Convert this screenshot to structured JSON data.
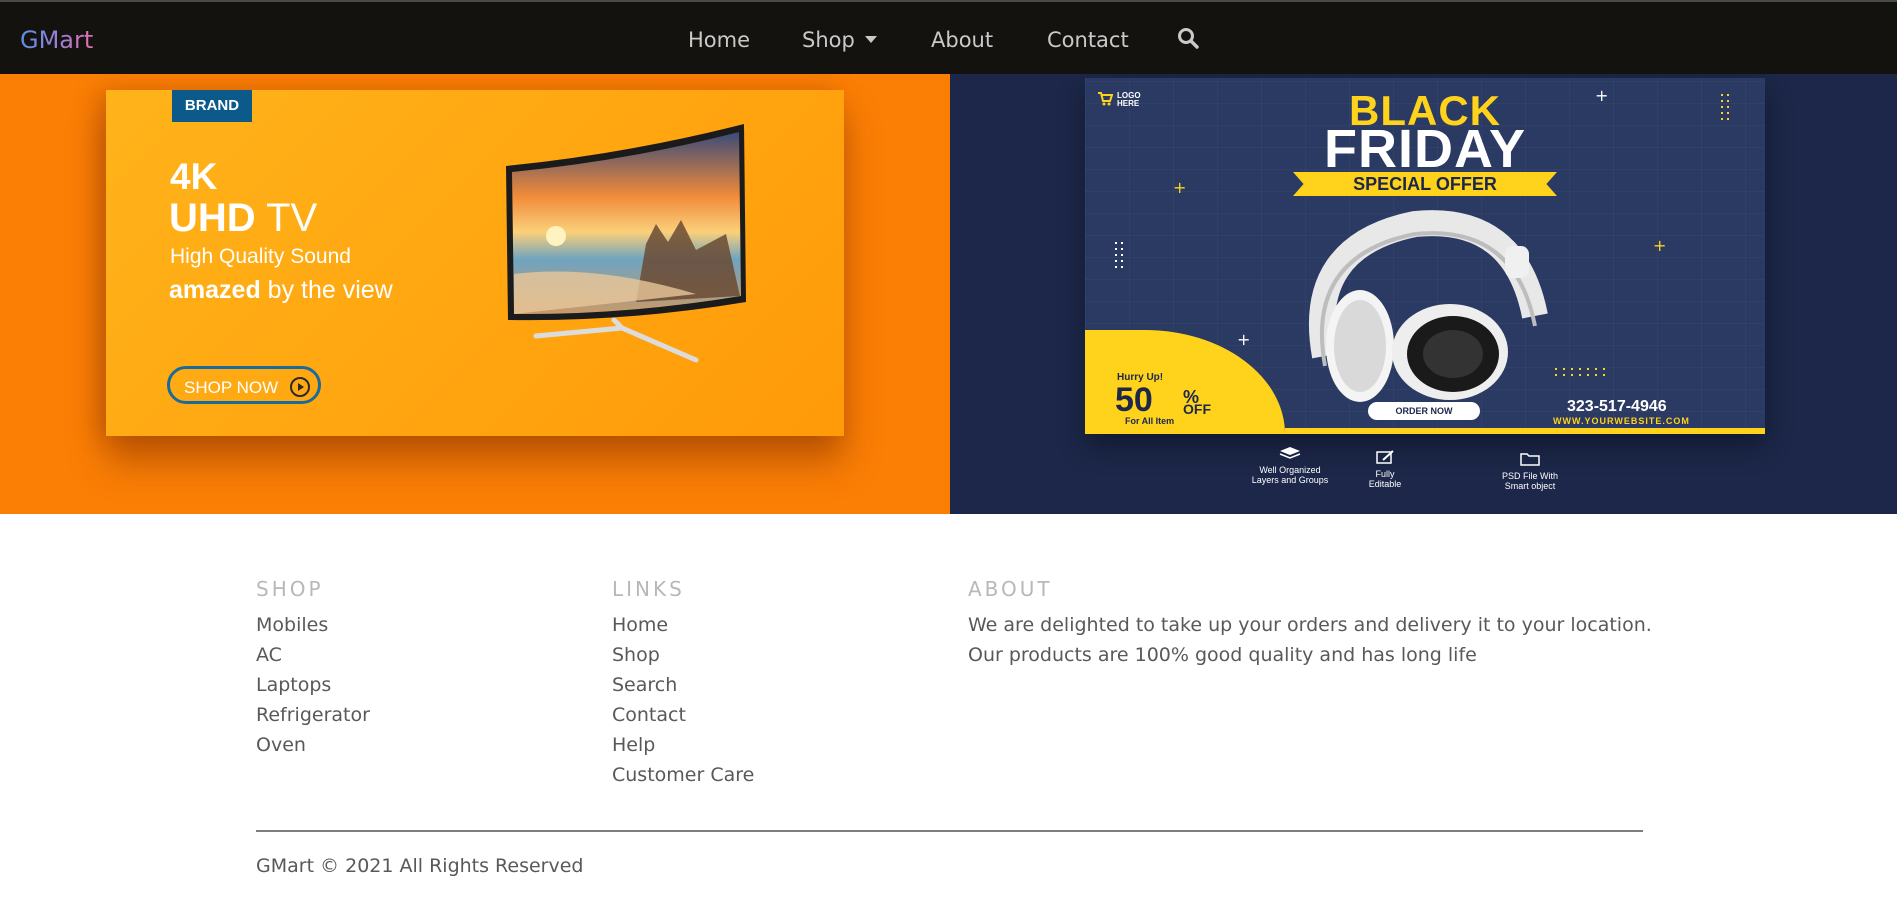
{
  "navbar": {
    "brand": "GMart",
    "items": [
      {
        "label": "Home"
      },
      {
        "label": "Shop"
      },
      {
        "label": "About"
      },
      {
        "label": "Contact"
      }
    ],
    "search_icon": "search-icon"
  },
  "banners": {
    "tv": {
      "brand_tag": "BRAND",
      "line1": "4K",
      "line2_bold": "UHD",
      "line2_rest": "TV",
      "subtitle": "High Quality Sound",
      "amazed_bold": "amazed",
      "amazed_rest": "by the view",
      "cta": "SHOP NOW",
      "background": "#fb7f05"
    },
    "black_friday": {
      "logo_line1": "LOGO",
      "logo_line2": "HERE",
      "title1": "BLACK",
      "title2": "FRIDAY",
      "special": "SPECIAL OFFER",
      "hurry": "Hurry Up!",
      "discount_number": "50",
      "discount_pct": "%",
      "discount_off": "OFF",
      "for_all": "For All Item",
      "order": "ORDER NOW",
      "phone": "323-517-4946",
      "website": "WWW.YOURWEBSITE.COM",
      "features": [
        {
          "line1": "Well Organized",
          "line2": "Layers and Groups"
        },
        {
          "line1": "Fully",
          "line2": "Editable"
        },
        {
          "line1": "PSD File With",
          "line2": "Smart object"
        }
      ],
      "background": "#1c2749",
      "accent": "#ffd21c"
    }
  },
  "footer": {
    "shop": {
      "heading": "SHOP",
      "links": [
        "Mobiles",
        "AC",
        "Laptops",
        "Refrigerator",
        "Oven"
      ]
    },
    "links": {
      "heading": "LINKS",
      "links": [
        "Home",
        "Shop",
        "Search",
        "Contact",
        "Help",
        "Customer Care"
      ]
    },
    "about": {
      "heading": "ABOUT",
      "line1": "We are delighted to take up your orders and delivery it to your location.",
      "line2": "Our products are 100% good quality and has long life"
    },
    "copyright": "GMart © 2021 All Rights Reserved"
  }
}
